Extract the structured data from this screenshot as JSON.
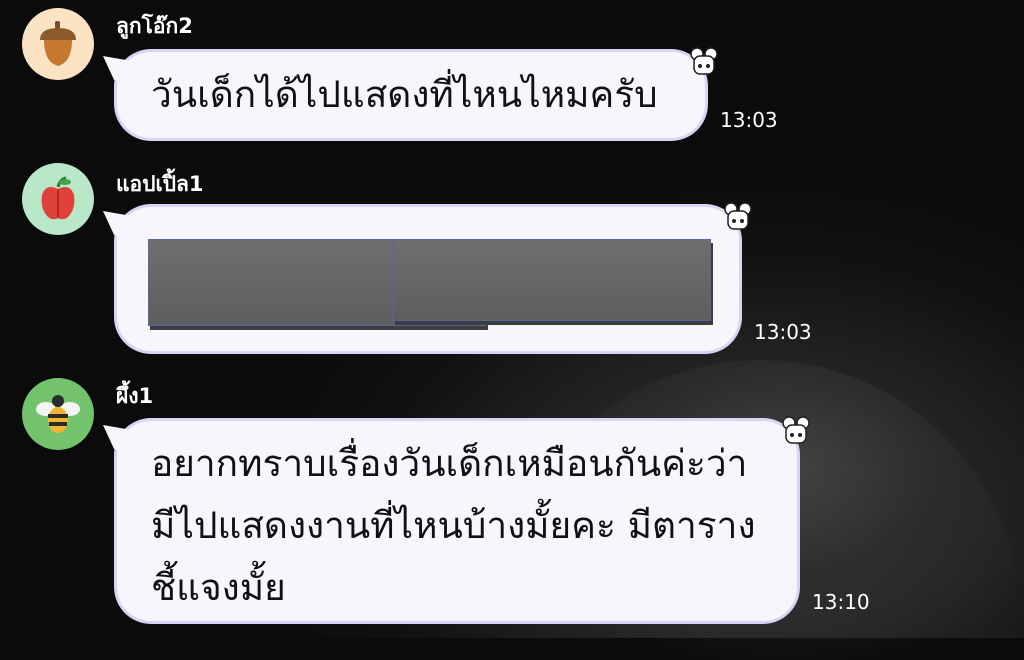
{
  "messages": [
    {
      "sender": "ลูกโอ๊ก2",
      "avatar_icon": "acorn-icon",
      "avatar_color": "#fbe3c3",
      "lines": [
        "วันเด็กได้ไปแสดงที่ไหนไหมครับ"
      ],
      "time": "13:03"
    },
    {
      "sender": "แอปเปิ้ล1",
      "avatar_icon": "apple-icon",
      "avatar_color": "#b8e8c8",
      "lines": [
        "[redacted]"
      ],
      "redacted": true,
      "time": "13:03"
    },
    {
      "sender": "ผึ้ง1",
      "avatar_icon": "bee-icon",
      "avatar_color": "#73c36d",
      "lines": [
        "อยากทราบเรื่องวันเด็กเหมือนกันค่ะว่า",
        "มีไปแสดงงานที่ไหนบ้างมั้ยคะ มีตาราง",
        "ชี้แจงมั้ย"
      ],
      "time": "13:10"
    }
  ],
  "colors": {
    "bubble_bg": "#f7f6fd",
    "bubble_border": "#d9d4f3",
    "text": "#111111",
    "meta_text": "#ffffff"
  },
  "icons": {
    "bubble_decoration": "mouse-sticker-icon"
  }
}
